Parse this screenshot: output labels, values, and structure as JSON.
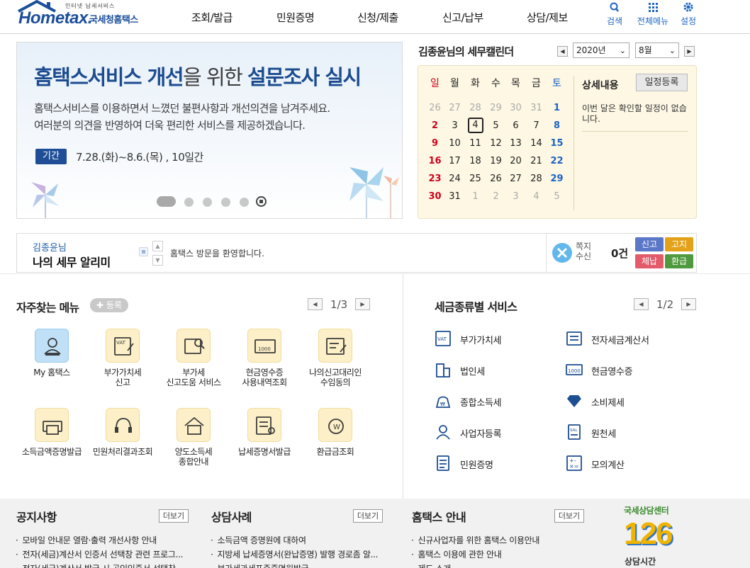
{
  "header": {
    "logo_small": "인터넷 납세서비스",
    "logo_main": "Hometax.",
    "logo_kr": "국세청홈택스",
    "nav": [
      "조회/발급",
      "민원증명",
      "신청/제출",
      "신고/납부",
      "상담/제보"
    ],
    "search_label": "검색",
    "allmenu_label": "전체메뉴",
    "settings_label": "설정"
  },
  "banner": {
    "title_bold1": "홈택스서비스 개선",
    "title_thin": "을 위한 ",
    "title_bold2": "설문조사 실시",
    "desc1": "홈택스서비스를 이용하면서 느꼈던 불편사항과 개선의견을 남겨주세요.",
    "desc2": "여러분의 의견을 반영하여 더욱 편리한 서비스를 제공하겠습니다.",
    "period_label": "기간",
    "period_text": "7.28.(화)~8.6.(목) , 10일간"
  },
  "calendar": {
    "title": "김종윤님의 세무캘린더",
    "year": "2020년",
    "month": "8월",
    "weekdays": [
      "일",
      "월",
      "화",
      "수",
      "목",
      "금",
      "토"
    ],
    "weeks": [
      [
        "26",
        "27",
        "28",
        "29",
        "30",
        "31",
        "1"
      ],
      [
        "2",
        "3",
        "4",
        "5",
        "6",
        "7",
        "8"
      ],
      [
        "9",
        "10",
        "11",
        "12",
        "13",
        "14",
        "15"
      ],
      [
        "16",
        "17",
        "18",
        "19",
        "20",
        "21",
        "22"
      ],
      [
        "23",
        "24",
        "25",
        "26",
        "27",
        "28",
        "29"
      ],
      [
        "30",
        "31",
        "1",
        "2",
        "3",
        "4",
        "5"
      ]
    ],
    "detail_label": "상세내용",
    "register_label": "일정등록",
    "detail_msg": "이번 달은 확인할 일정이 없습니다."
  },
  "alert": {
    "user": "김종윤님",
    "title": "나의 세무 알리미",
    "message": "홈택스 방문을 환영합니다.",
    "note_label1": "쪽지",
    "note_label2": "수신",
    "note_count": "0건",
    "btns": [
      "신고",
      "고지",
      "체납",
      "환급"
    ]
  },
  "favorites": {
    "title": "자주찾는 메뉴",
    "register": "등록",
    "page": "1/3",
    "items": [
      [
        "My 홈택스"
      ],
      [
        "부가가치세",
        "신고"
      ],
      [
        "부가세",
        "신고도움 서비스"
      ],
      [
        "현금영수증",
        "사용내역조회"
      ],
      [
        "나의신고대리인",
        "수임동의"
      ],
      [
        "소득금액증명발급"
      ],
      [
        "민원처리결과조회"
      ],
      [
        "양도소득세",
        "종합안내"
      ],
      [
        "납세증명서발급"
      ],
      [
        "환급금조회"
      ]
    ]
  },
  "taxservice": {
    "title": "세금종류별 서비스",
    "page": "1/2",
    "left": [
      "부가가치세",
      "법인세",
      "종합소득세",
      "사업자등록",
      "민원증명"
    ],
    "right": [
      "전자세금계산서",
      "현금영수증",
      "소비제세",
      "원천세",
      "모의계산"
    ]
  },
  "footer": {
    "notice_title": "공지사항",
    "cases_title": "상담사례",
    "guide_title": "홈택스 안내",
    "more": "더보기",
    "notice": [
      "모바일 안내문 열람·출력 개선사항 안내",
      "전자(세금)계산서 인증서 선택창 관련 프로그...",
      "전자(세금)계산서 발급 시 공인인증서 선택창"
    ],
    "cases": [
      "소득금액 증명원에 대하여",
      "지방세 납세증명서(완납증명) 발행 경로좀 알...",
      "부가세과세표준증명원발급"
    ],
    "guide": [
      "신규사업자를 위한 홈택스 이용안내",
      "홈택스 이용에 관한 안내",
      "제도 소개"
    ],
    "center_label": "국세상담센터",
    "center_number": "126",
    "hours_label": "상담시간"
  }
}
